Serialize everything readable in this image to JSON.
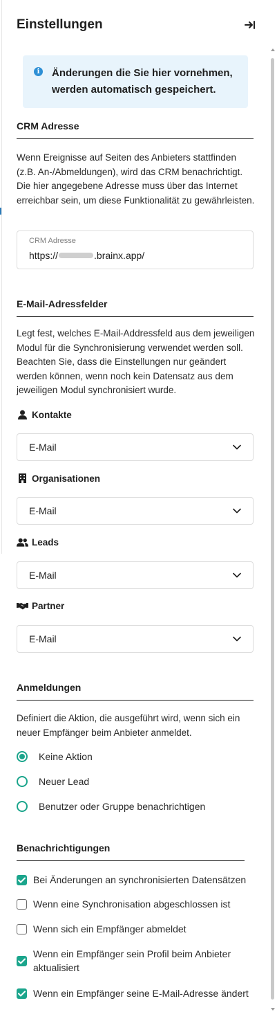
{
  "panel": {
    "title": "Einstellungen",
    "collapse_icon": "collapse-right-icon"
  },
  "info": {
    "icon": "info-icon",
    "text": "Änderungen die Sie hier vornehmen, werden automatisch gespeichert."
  },
  "crm": {
    "title": "CRM Adresse",
    "description": "Wenn Ereignisse auf Seiten des Anbieters stattfinden (z.B. An-/Abmeldungen), wird das CRM benachrichtigt. Die hier angegebene Adresse muss über das Internet erreichbar sein, um diese Funktionalität zu gewährleisten.",
    "field_label": "CRM Adresse",
    "value_prefix": "https://",
    "value_suffix": ".brainx.app/"
  },
  "email_fields": {
    "title": "E-Mail-Adressfelder",
    "description": "Legt fest, welches E-Mail-Addressfeld aus dem jeweiligen Modul für die Synchronisierung verwendet werden soll. Beachten Sie, dass die Einstellungen nur geändert werden können, wenn noch kein Datensatz aus dem jeweiligen Modul synchronisiert wurde.",
    "modules": [
      {
        "label": "Kontakte",
        "icon": "person-icon",
        "value": "E-Mail"
      },
      {
        "label": "Organisationen",
        "icon": "building-icon",
        "value": "E-Mail"
      },
      {
        "label": "Leads",
        "icon": "users-icon",
        "value": "E-Mail"
      },
      {
        "label": "Partner",
        "icon": "handshake-icon",
        "value": "E-Mail"
      }
    ]
  },
  "signups": {
    "title": "Anmeldungen",
    "description": "Definiert die Aktion, die ausgeführt wird, wenn sich ein neuer Empfänger beim Anbieter anmeldet.",
    "options": [
      {
        "label": "Keine Aktion",
        "selected": true
      },
      {
        "label": "Neuer Lead",
        "selected": false
      },
      {
        "label": "Benutzer oder Gruppe benachrichtigen",
        "selected": false
      }
    ]
  },
  "notifications": {
    "title": "Benachrichtigungen",
    "items": [
      {
        "label": "Bei Änderungen an synchronisierten Datensätzen",
        "checked": true
      },
      {
        "label": "Wenn eine Synchronisation abgeschlossen ist",
        "checked": false
      },
      {
        "label": "Wenn sich ein Empfänger abmeldet",
        "checked": false
      },
      {
        "label": "Wenn ein Empfänger sein Profil beim Anbieter aktualisiert",
        "checked": true
      },
      {
        "label": "Wenn ein Empfänger seine E-Mail-Adresse ändert",
        "checked": true
      }
    ]
  },
  "colors": {
    "accent": "#1ba58c",
    "info_background": "#e8f4fc",
    "info_icon": "#2d8fd5"
  }
}
